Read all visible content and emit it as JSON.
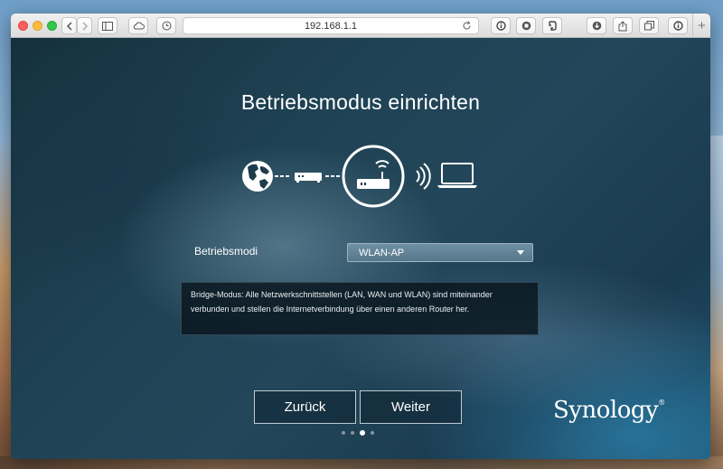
{
  "browser": {
    "url": "192.168.1.1",
    "icons": [
      "back-icon",
      "forward-icon",
      "sidebar-icon",
      "icloud-icon",
      "history-icon",
      "reload-icon",
      "info-icon",
      "stop-icon",
      "evernote-icon",
      "download-icon",
      "share-icon",
      "tabs-icon",
      "reader-icon",
      "new-tab-icon"
    ]
  },
  "page": {
    "title": "Betriebsmodus einrichten",
    "mode_label": "Betriebsmodi",
    "mode_value": "WLAN-AP",
    "info_text": "Bridge-Modus: Alle Netzwerkschnittstellen (LAN, WAN und WLAN) sind miteinander verbunden und stellen die Internetverbindung über einen anderen Router her.",
    "back_label": "Zurück",
    "next_label": "Weiter",
    "logo_text": "Synology",
    "pagination": {
      "total": 4,
      "current": 3
    }
  },
  "colors": {
    "accent": "#ffffff",
    "background": "#1f4354"
  }
}
